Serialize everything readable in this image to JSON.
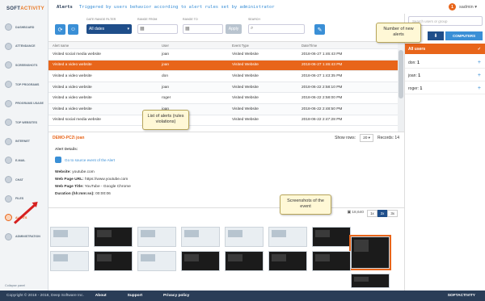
{
  "app": {
    "logo": "SOFT",
    "logo_suffix": "ACTIVITY",
    "user": "sadmin",
    "alert_count": "1"
  },
  "header": {
    "title": "Alerts",
    "subtitle": "Triggered by users behavior according to alert rules set by administrator"
  },
  "sidebar": {
    "items": [
      "DASHBOARD",
      "ATTENDANCE",
      "SCREENSHOTS",
      "TOP PROGRAMS",
      "PROGRAMS USAGE",
      "TOP WEBSITES",
      "INTERNET",
      "E-MAIL",
      "CHAT",
      "FILES",
      "ALERTS",
      "ADMINISTRATION"
    ],
    "collapse": "Collapse panel"
  },
  "filters": {
    "date_label": "DATE RANGE FILTER",
    "date_value": "All dates",
    "from_label": "RANGE FROM",
    "to_label": "RANGE TO",
    "apply": "Apply",
    "search_label": "SEARCH"
  },
  "grid": {
    "columns": [
      "Alert name",
      "User",
      "Event Type",
      "Date/Time"
    ],
    "rows": [
      [
        "Visited social media website",
        "joan",
        "Visited Website",
        "2018-06-27 1:46:43 PM"
      ],
      [
        "Visited a video website",
        "joan",
        "Visited Website",
        "2018-06-27 1:46:43 PM"
      ],
      [
        "Visited a video website",
        "don",
        "Visited Website",
        "2018-06-27 1:43:35 PM"
      ],
      [
        "Visited a video website",
        "joan",
        "Visited Website",
        "2018-06-22 2:58:10 PM"
      ],
      [
        "Visited a video website",
        "roger",
        "Visited Website",
        "2018-06-22 2:58:00 PM"
      ],
      [
        "Visited a video website",
        "joan",
        "Visited Website",
        "2018-06-22 2:48:50 PM"
      ],
      [
        "Visited social media website",
        "joan",
        "Visited Website",
        "2018-06-22 2:47:28 PM"
      ]
    ]
  },
  "footer_bar": {
    "pc": "DEMO-PC2\\ joan",
    "show_rows_label": "Show rows:",
    "show_rows_value": "20",
    "records_label": "Records: 14"
  },
  "details": {
    "title": "Alert Details:",
    "source_link": "Go to source event of the Alert",
    "website_label": "Website:",
    "website_value": "youtube.com",
    "url_label": "Web Page URL:",
    "url_value": "https://www.youtube.com",
    "page_title_label": "Web Page Title:",
    "page_title_value": "YouTube - Google Chrome",
    "duration_label": "Duration (hh:mm:ss):",
    "duration_value": "00:00:06"
  },
  "shots": {
    "count": "18,640",
    "zoom": [
      "1x",
      "2x",
      "3x"
    ],
    "zoom_selected": "2x"
  },
  "right": {
    "search_placeholder": "Search users or group",
    "computers_label": "COMPUTERS",
    "all_users": "All users",
    "users": [
      {
        "name": "don:",
        "count": "1"
      },
      {
        "name": "joan:",
        "count": "1"
      },
      {
        "name": "roger:",
        "count": "1"
      }
    ]
  },
  "footer": {
    "copyright": "Copyright © 2018 - 2018, Deep Software Inc.",
    "about": "About",
    "support": "Support",
    "privacy": "Privacy policy",
    "brand": "SOFTACTIVITY"
  },
  "callouts": {
    "new_alerts": "Number of new alerts",
    "list": "List of alerts (rules violations)",
    "screens": "Screenshots of the event"
  },
  "colors": {
    "accent": "#e8651a",
    "primary": "#1f4e8a",
    "link": "#3a8fd6"
  }
}
